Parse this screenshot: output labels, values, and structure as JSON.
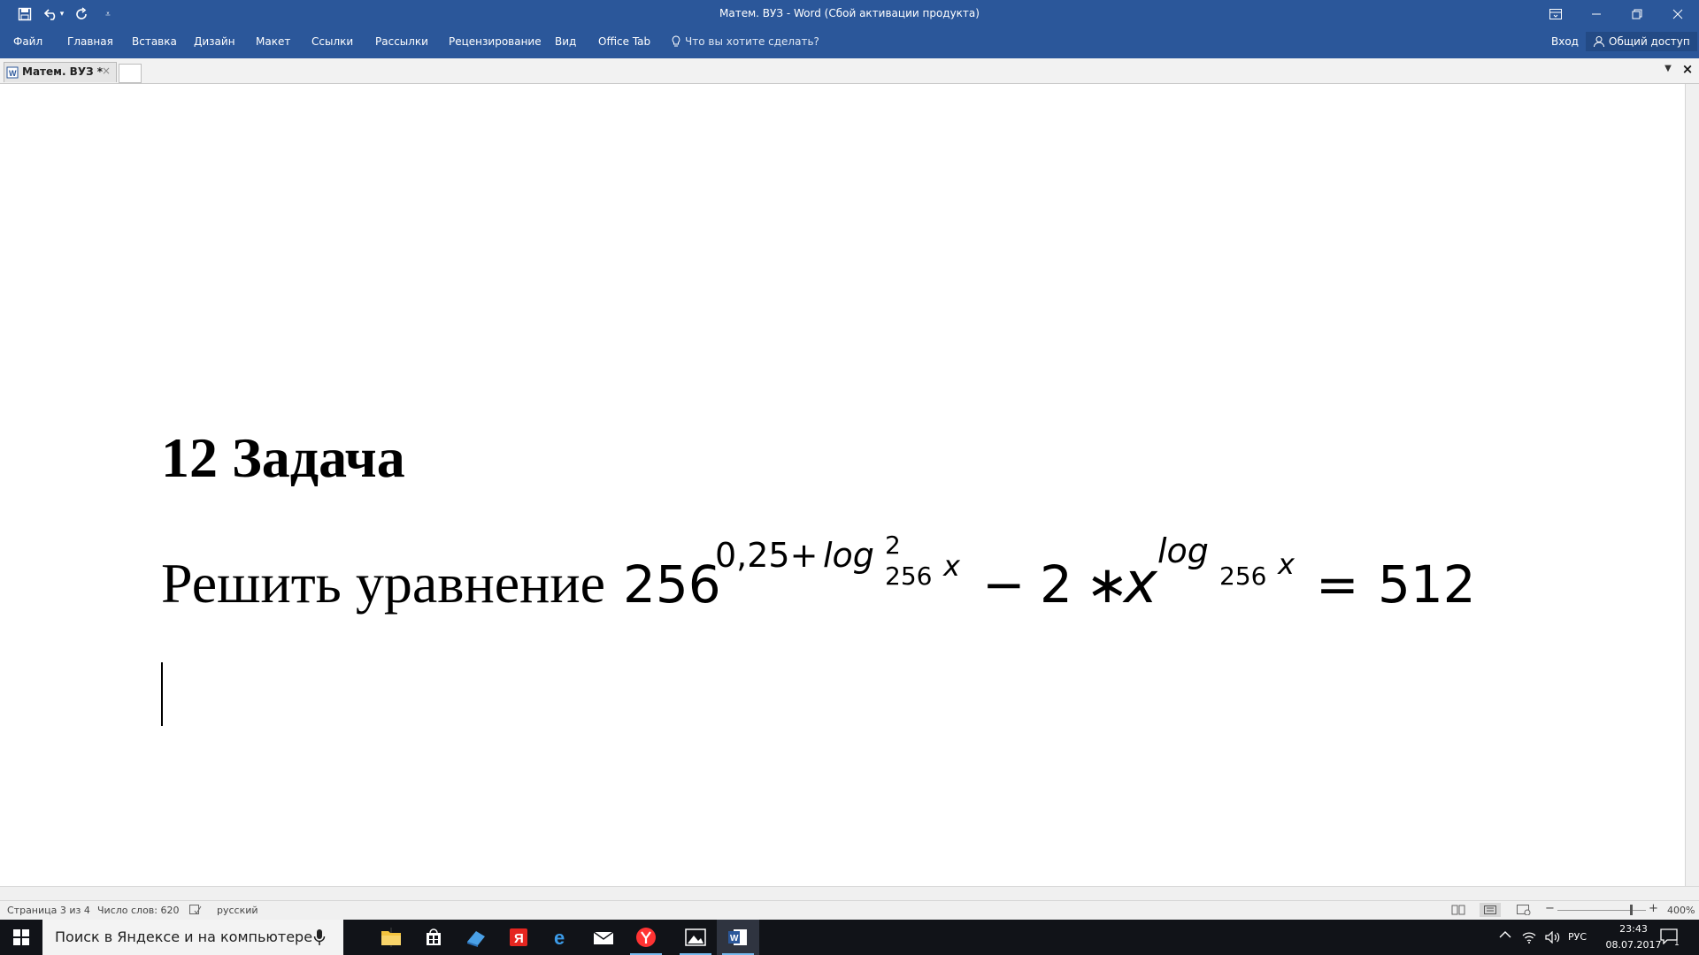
{
  "window": {
    "title": "Матем. ВУЗ - Word (Сбой активации продукта)"
  },
  "ribbon": {
    "tabs": [
      "Файл",
      "Главная",
      "Вставка",
      "Дизайн",
      "Макет",
      "Ссылки",
      "Рассылки",
      "Рецензирование",
      "Вид",
      "Office Tab"
    ],
    "tell_me": "Что вы хотите сделать?",
    "sign_in": "Вход",
    "share": "Общий доступ"
  },
  "office_tab": {
    "document_tab": "Матем. ВУЗ *"
  },
  "document": {
    "heading": "12 Задача",
    "equation_label": "Решить уравнение",
    "equation": {
      "base": "256",
      "exp_constant": "0,25+",
      "log": "log",
      "log_power": "2",
      "log_base": "256",
      "log_arg": "x",
      "minus": "−",
      "coef": "2",
      "mult": "∗",
      "var": "x",
      "rhs_equals": "=",
      "rhs": "512"
    }
  },
  "statusbar": {
    "page": "Страница 3 из 4",
    "words": "Число слов: 620",
    "language": "русский",
    "zoom": "400%"
  },
  "taskbar": {
    "search_placeholder": "Поиск в Яндексе и на компьютере",
    "language": "РУС",
    "time": "23:43",
    "date": "08.07.2017",
    "notification_count": "1"
  },
  "colors": {
    "word_blue": "#2b579a",
    "taskbar": "#111318"
  }
}
